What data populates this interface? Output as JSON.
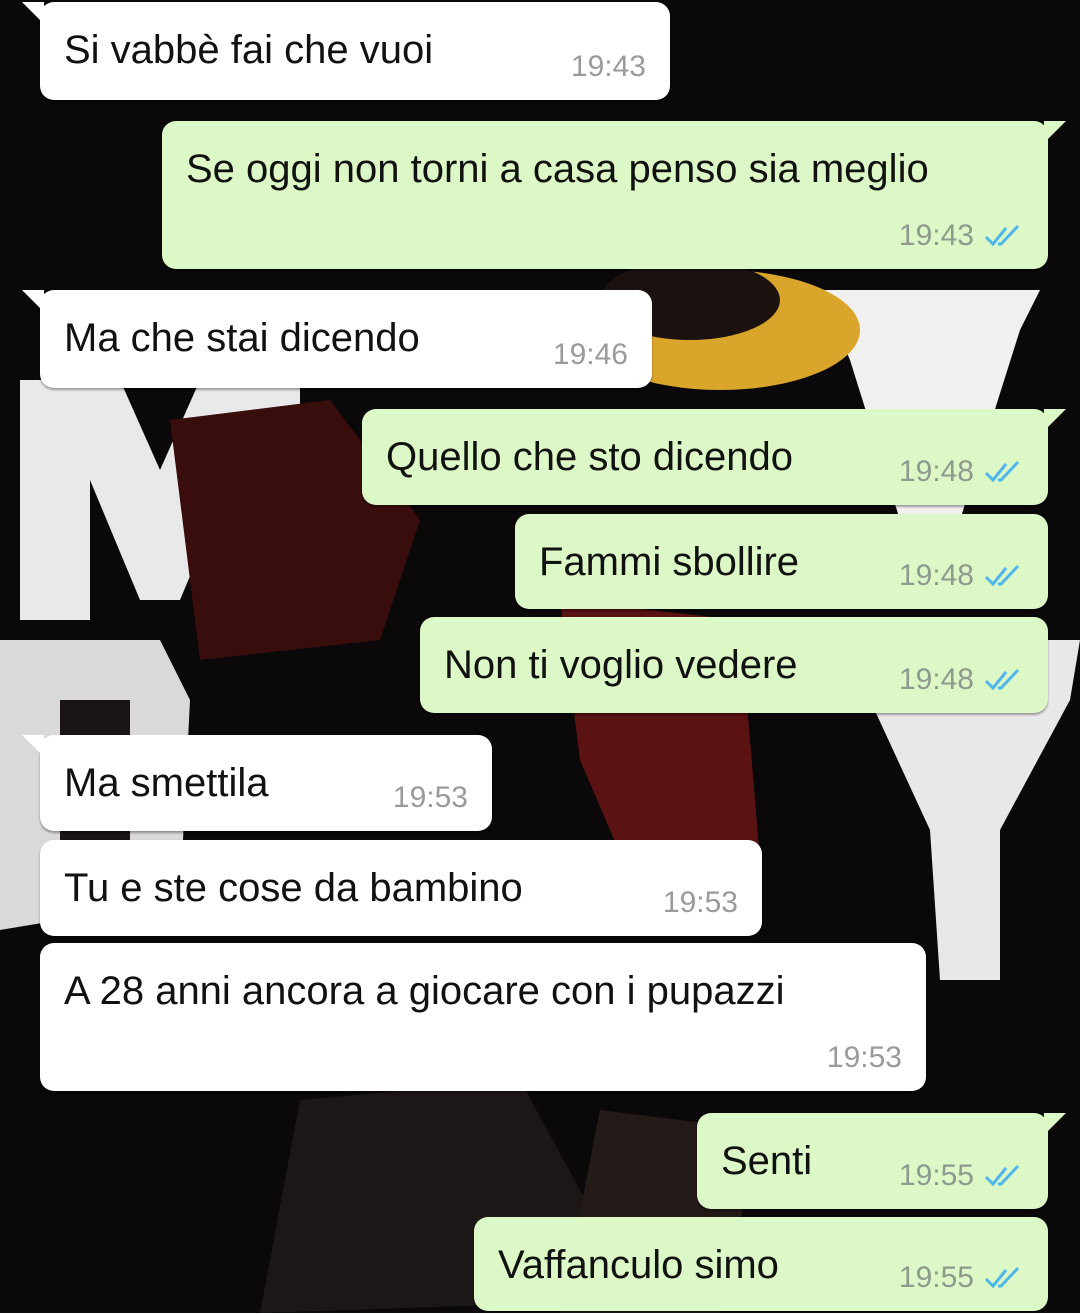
{
  "colors": {
    "incoming_bubble": "#ffffff",
    "outgoing_bubble": "#dcf8c6",
    "read_tick": "#4fb6ec",
    "wallpaper": "#0a0808"
  },
  "messages": [
    {
      "direction": "incoming",
      "text": "Si vabbè fai che vuoi",
      "time": "19:43"
    },
    {
      "direction": "outgoing",
      "text": "Se oggi non torni a casa penso sia meglio",
      "time": "19:43",
      "status_icon": "double-check-read-icon"
    },
    {
      "direction": "incoming",
      "text": "Ma che stai dicendo",
      "time": "19:46"
    },
    {
      "direction": "outgoing",
      "text": "Quello che sto dicendo",
      "time": "19:48",
      "status_icon": "double-check-read-icon"
    },
    {
      "direction": "outgoing",
      "text": "Fammi sbollire",
      "time": "19:48",
      "status_icon": "double-check-read-icon"
    },
    {
      "direction": "outgoing",
      "text": "Non ti voglio vedere",
      "time": "19:48",
      "status_icon": "double-check-read-icon"
    },
    {
      "direction": "incoming",
      "text": "Ma smettila",
      "time": "19:53"
    },
    {
      "direction": "incoming",
      "text": "Tu e ste cose da bambino",
      "time": "19:53"
    },
    {
      "direction": "incoming",
      "text": "A 28 anni ancora a giocare con i pupazzi",
      "time": "19:53"
    },
    {
      "direction": "outgoing",
      "text": "Senti",
      "time": "19:55",
      "status_icon": "double-check-read-icon"
    },
    {
      "direction": "outgoing",
      "text": "Vaffanculo simo",
      "time": "19:55",
      "status_icon": "double-check-read-icon"
    }
  ]
}
